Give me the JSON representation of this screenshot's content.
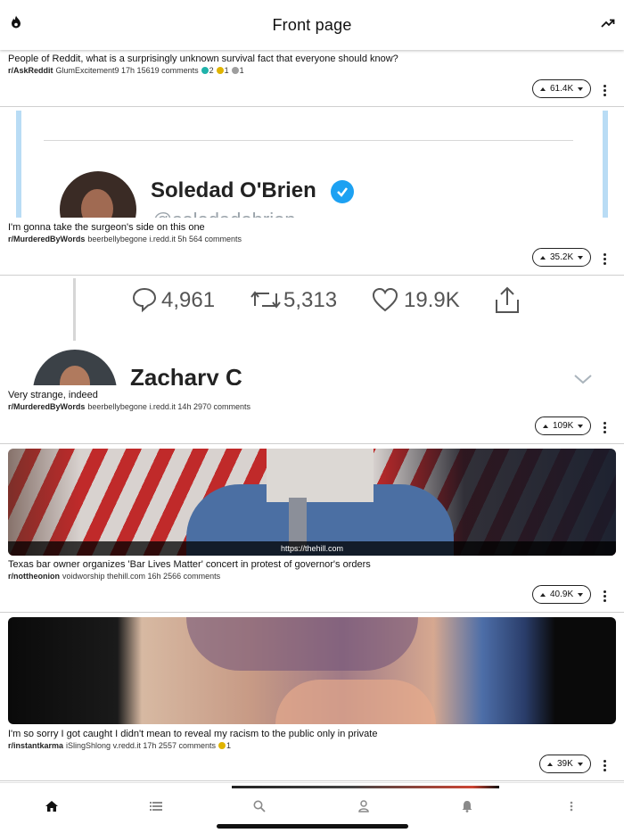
{
  "header": {
    "title": "Front page",
    "left_icon": "flame-icon",
    "right_icon": "trending-icon"
  },
  "posts": [
    {
      "title": "People of Reddit, what is a surprisingly unknown survival fact that everyone should know?",
      "subreddit": "r/AskReddit",
      "meta": "GlumExcitement9 17h 15619 comments",
      "awards": [
        {
          "color": "#20b2aa",
          "count": "2"
        },
        {
          "color": "#e0b400",
          "count": "1"
        },
        {
          "color": "#9e9e9e",
          "count": "1"
        }
      ],
      "score": "61.4K"
    },
    {
      "title": "I'm gonna take the surgeon's side on this one",
      "subreddit": "r/MurderedByWords",
      "meta": "beerbellybegone i.redd.it 5h 564 comments",
      "score": "35.2K",
      "preview": {
        "name": "Soledad O'Brien",
        "handle": "@soledadobrien"
      }
    },
    {
      "title": "Very strange, indeed",
      "subreddit": "r/MurderedByWords",
      "meta": "beerbellybegone i.redd.it 14h 2970 comments",
      "score": "109K",
      "preview": {
        "replies": "4,961",
        "retweets": "5,313",
        "likes": "19.9K",
        "name": "Zachary C"
      }
    },
    {
      "title": "Texas bar owner organizes 'Bar Lives Matter' concert in protest of governor's orders",
      "subreddit": "r/nottheonion",
      "meta": "voidworship thehill.com 16h 2566 comments",
      "score": "40.9K",
      "link": "https://thehill.com"
    },
    {
      "title": "I'm so sorry I got caught I didn't mean to reveal my racism to the public only in private",
      "subreddit": "r/instantkarma",
      "meta": "iSlingShlong v.redd.it 17h 2557 comments",
      "awards": [
        {
          "color": "#e0b400",
          "count": "1"
        }
      ],
      "score": "39K"
    }
  ],
  "bottom_nav": [
    "home-icon",
    "list-icon",
    "search-icon",
    "profile-icon",
    "bell-icon",
    "more-icon"
  ]
}
